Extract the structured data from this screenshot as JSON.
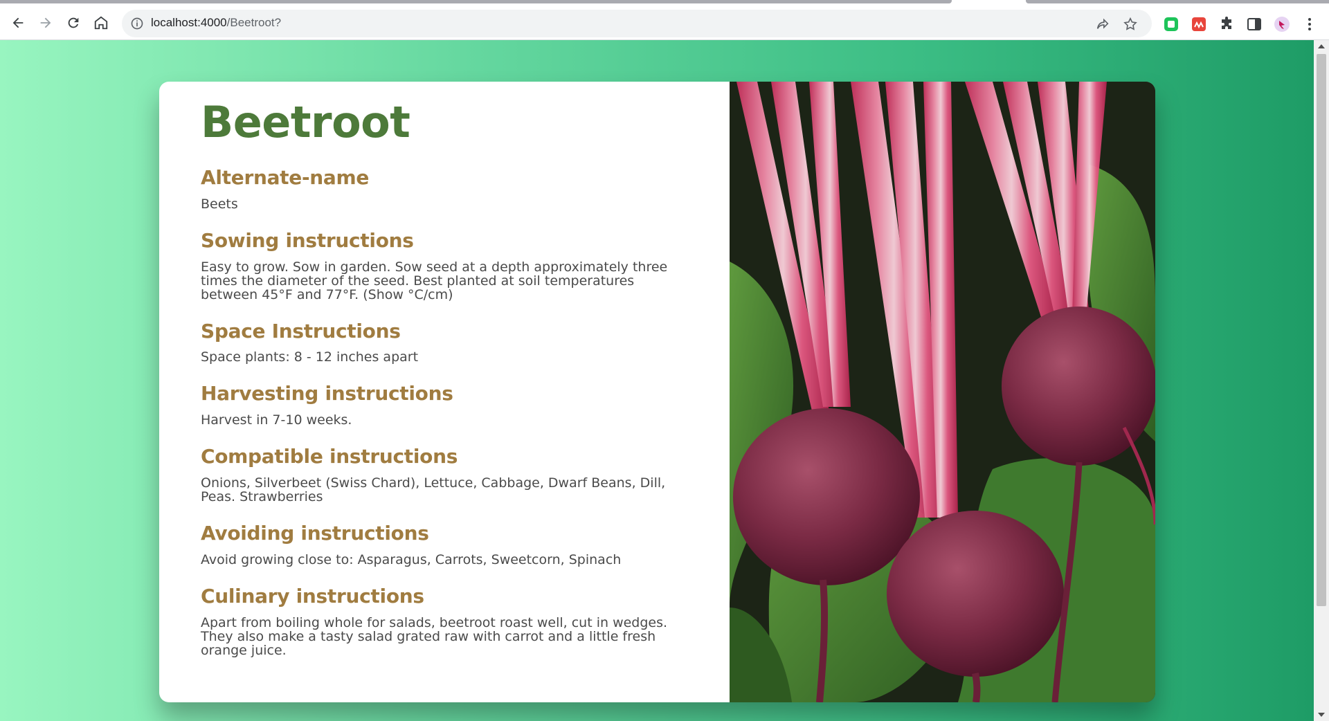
{
  "browser": {
    "url_host": "localhost:4000",
    "url_path": "/Beetroot?"
  },
  "page": {
    "title": "Beetroot",
    "sections": [
      {
        "heading": "Alternate-name",
        "text": "Beets"
      },
      {
        "heading": "Sowing instructions",
        "text": "Easy to grow. Sow in garden. Sow seed at a depth approximately three times the diameter of the seed. Best planted at soil temperatures between 45°F and 77°F. (Show °C/cm)"
      },
      {
        "heading": "Space Instructions",
        "text": "Space plants: 8 - 12 inches apart"
      },
      {
        "heading": "Harvesting instructions",
        "text": "Harvest in 7-10 weeks."
      },
      {
        "heading": "Compatible instructions",
        "text": "Onions, Silverbeet (Swiss Chard), Lettuce, Cabbage, Dwarf Beans, Dill, Peas. Strawberries"
      },
      {
        "heading": "Avoiding instructions",
        "text": "Avoid growing close to: Asparagus, Carrots, Sweetcorn, Spinach"
      },
      {
        "heading": "Culinary instructions",
        "text": "Apart from boiling whole for salads, beetroot roast well, cut in wedges. They also make a tasty salad grated raw with carrot and a little fresh orange juice."
      }
    ]
  },
  "colors": {
    "title": "#4d7a3a",
    "heading": "#a07c40",
    "body_text": "#4a4a4a",
    "background_left": "#98f5c0",
    "background_right": "#1e9c66"
  },
  "icons": {
    "back": "arrow-left-icon",
    "forward": "arrow-right-icon",
    "reload": "reload-icon",
    "home": "home-icon",
    "site_info": "info-icon",
    "share": "share-icon",
    "bookmark": "star-icon",
    "extensions": "puzzle-icon",
    "side_panel": "side-panel-icon",
    "menu": "kebab-menu-icon"
  }
}
